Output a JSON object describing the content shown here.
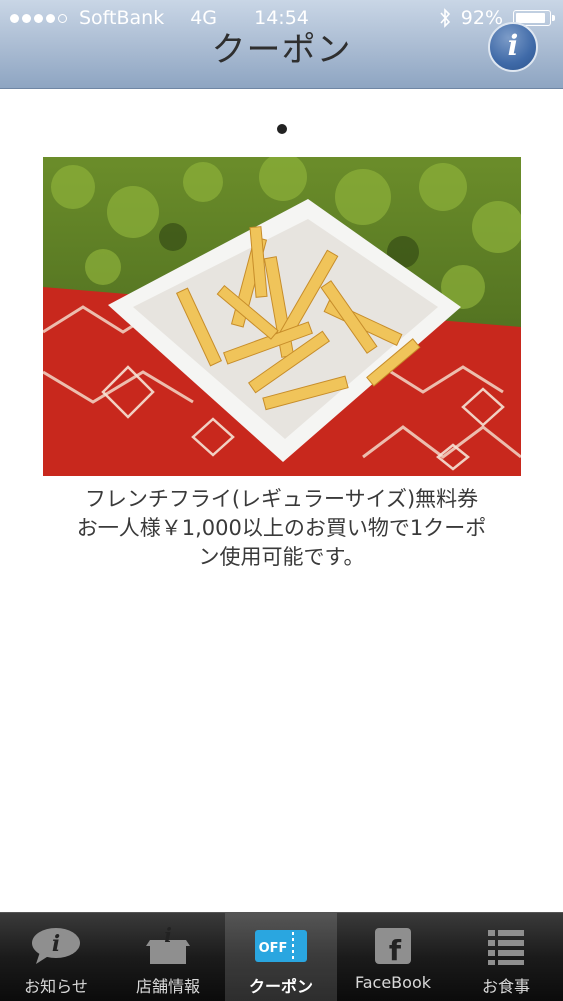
{
  "status_bar": {
    "carrier": "SoftBank",
    "network": "4G",
    "time": "14:54",
    "battery_text": "92%",
    "battery_level": 0.92,
    "signal_bars": 4,
    "icons": [
      "signal-dots-icon",
      "bluetooth-icon",
      "battery-icon"
    ]
  },
  "header": {
    "title": "クーポン",
    "info_label": "i"
  },
  "pager": {
    "pages": 1,
    "current": 1
  },
  "coupon": {
    "image": "french-fries-photo",
    "lines": [
      "フレンチフライ(レギュラーサイズ)無料券",
      "お一人様￥1,000以上のお買い物で1クーポ",
      "ン使用可能です。"
    ]
  },
  "tabbar": {
    "items": [
      {
        "label": "お知らせ",
        "icon": "speech-bubble-info-icon"
      },
      {
        "label": "店舗情報",
        "icon": "store-info-icon"
      },
      {
        "label": "クーポン",
        "icon": "coupon-off-ticket-icon",
        "active": true
      },
      {
        "label": "FaceBook",
        "icon": "facebook-icon"
      },
      {
        "label": "お食事",
        "icon": "menu-list-icon"
      }
    ]
  },
  "colors": {
    "header_top": "#c9d6e6",
    "header_bottom": "#8ea5c2",
    "tabbar": "#1b1b1b",
    "coupon_icon": "#2aa6e0"
  }
}
